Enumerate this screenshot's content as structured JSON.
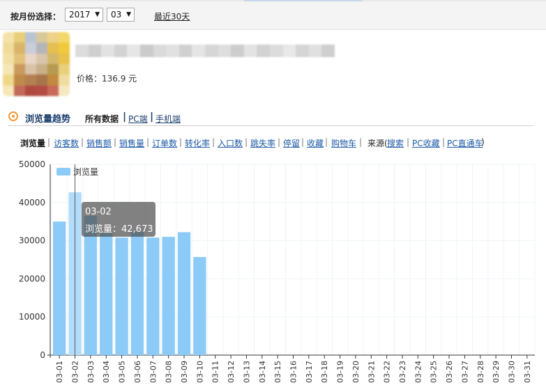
{
  "filter": {
    "month_label": "按月份选择：",
    "year_value": "2017",
    "month_value": "03",
    "recent_link": "最近30天"
  },
  "product": {
    "price_label": "价格：136.9 元"
  },
  "trend": {
    "title": "浏览量趋势",
    "source_all": "所有数据",
    "source_pc": "PC端",
    "source_mobile": "手机端",
    "accent_color": "#f19a38"
  },
  "metrics": {
    "items": [
      "浏览量",
      "访客数",
      "销售额",
      "销售量",
      "订单数",
      "转化率",
      "入口数",
      "跳失率",
      "停留",
      "收藏",
      "购物车"
    ],
    "source_prefix": "来源(",
    "source_items": [
      "搜索",
      "PC收藏",
      "PC直通车"
    ],
    "source_suffix": ")"
  },
  "tooltip": {
    "date": "03-02",
    "line": "浏览量：42,673"
  },
  "colors": {
    "bar": "#8ccaf7",
    "bar_highlight": "#b2dcfa",
    "grid": "#eef3f8",
    "axis": "#333333"
  },
  "chart_data": {
    "type": "bar",
    "legend": "浏览量",
    "legend_position": "top-left",
    "grid": true,
    "ylim": [
      0,
      50000
    ],
    "yticks": [
      0,
      10000,
      20000,
      30000,
      40000,
      50000
    ],
    "categories": [
      "03-01",
      "03-02",
      "03-03",
      "03-04",
      "03-05",
      "03-06",
      "03-07",
      "03-08",
      "03-09",
      "03-10",
      "03-11",
      "03-12",
      "03-13",
      "03-14",
      "03-15",
      "03-16",
      "03-17",
      "03-18",
      "03-19",
      "03-20",
      "03-21",
      "03-22",
      "03-23",
      "03-24",
      "03-25",
      "03-26",
      "03-27",
      "03-28",
      "03-29",
      "03-30",
      "03-31"
    ],
    "values": [
      35000,
      42673,
      36500,
      32000,
      30800,
      32400,
      30800,
      31000,
      32200,
      25700,
      null,
      null,
      null,
      null,
      null,
      null,
      null,
      null,
      null,
      null,
      null,
      null,
      null,
      null,
      null,
      null,
      null,
      null,
      null,
      null,
      null
    ],
    "highlight_index": 1
  }
}
